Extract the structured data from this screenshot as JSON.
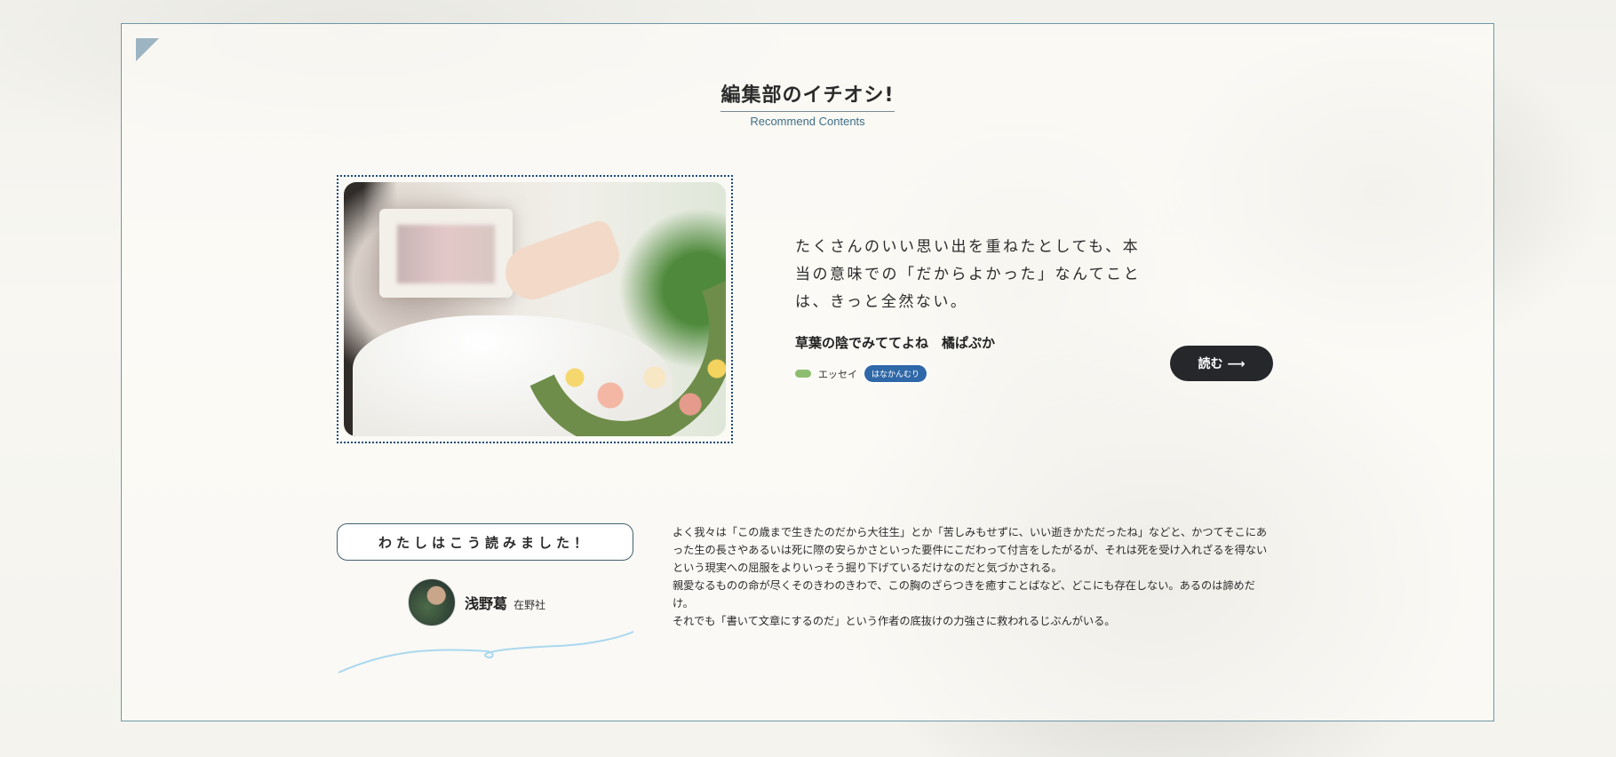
{
  "section": {
    "title": "編集部のイチオシ!",
    "subtitle": "Recommend Contents"
  },
  "featured": {
    "quote": "たくさんのいい思い出を重ねたとしても、本当の意味での「だからよかった」なんてことは、きっと全然ない。",
    "article_title": "草葉の陰でみててよね　橘ぱぷか",
    "category": "エッセイ",
    "tag": "はなかんむり",
    "read_button": "読む ⟶"
  },
  "reader": {
    "heading": "わたしはこう読みました！",
    "name": "浅野葛",
    "org": "在野社"
  },
  "review": {
    "p1": "よく我々は「この歳まで生きたのだから大往生」とか「苦しみもせずに、いい逝きかただったね」などと、かつてそこにあった生の長さやあるいは死に際の安らかさといった要件にこだわって付言をしたがるが、それは死を受け入れざるを得ないという現実への屈服をよりいっそう掘り下げているだけなのだと気づかされる。",
    "p2": "親愛なるものの命が尽くそのきわのきわで、この胸のざらつきを癒すことばなど、どこにも存在しない。あるのは諦めだけ。",
    "p3": "それでも「書いて文章にするのだ」という作者の底抜けの力強さに救われるじぶんがいる。"
  },
  "colors": {
    "frame_border": "#6f97a8",
    "subtitle": "#3f6e86",
    "tag_bg": "#2f68a8",
    "category_dot": "#8dbd71",
    "button_bg": "#25272b"
  },
  "icons": {
    "corner": "corner-triangle-icon",
    "arrow": "arrow-right-icon"
  }
}
